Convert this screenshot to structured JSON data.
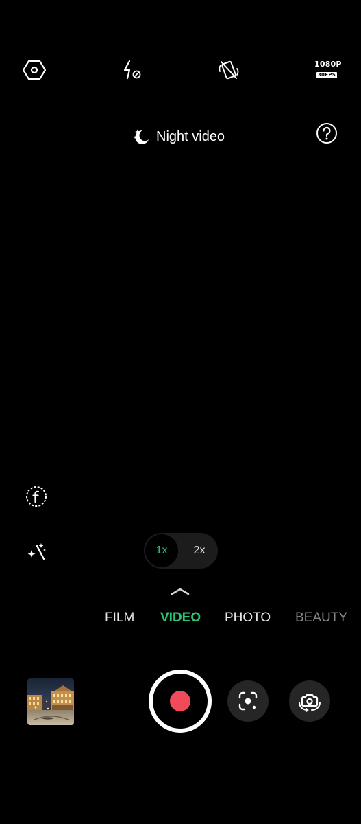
{
  "top_bar": {
    "settings_icon": "hexagon-settings-icon",
    "flash_icon": "flash-off-icon",
    "stabilization_icon": "stabilization-off-icon",
    "resolution": {
      "top": "1080P",
      "bottom": "30FPS"
    }
  },
  "night_mode": {
    "icon": "moon-stars-icon",
    "label": "Night video"
  },
  "help_icon": "help-icon",
  "side_tools": {
    "filter_icon": "filter-f-icon",
    "enhance_icon": "sparkle-wand-icon"
  },
  "zoom": {
    "options": [
      {
        "label": "1x",
        "active": true
      },
      {
        "label": "2x",
        "active": false
      }
    ]
  },
  "expand_icon": "chevron-up-icon",
  "modes": [
    {
      "label": "FILM",
      "state": "inactive"
    },
    {
      "label": "VIDEO",
      "state": "active"
    },
    {
      "label": "PHOTO",
      "state": "inactive"
    },
    {
      "label": "BEAUTY",
      "state": "faded"
    }
  ],
  "bottom": {
    "gallery_thumb": "gallery-thumbnail",
    "record_icon": "record-icon",
    "lens_icon": "google-lens-icon",
    "flip_icon": "flip-camera-icon"
  },
  "colors": {
    "accent": "#2fc47a",
    "record": "#f04a5b",
    "background": "#000000"
  }
}
